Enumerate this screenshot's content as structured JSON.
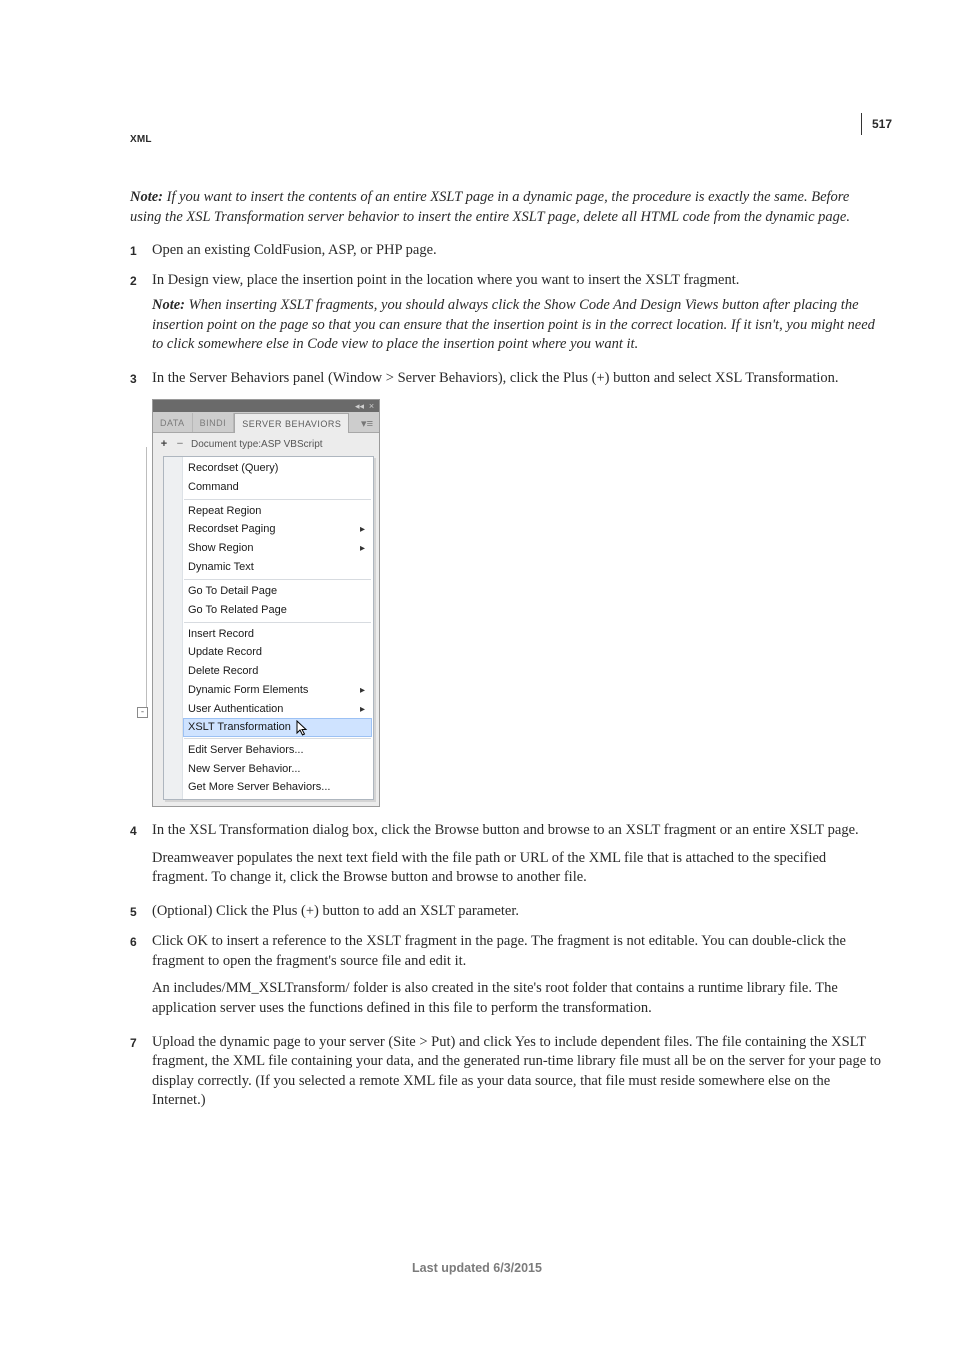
{
  "page_number": "517",
  "running_head": "XML",
  "intro_note": {
    "label": "Note:",
    "text": " If you want to insert the contents of an entire XSLT page in a dynamic page, the procedure is exactly the same. Before using the XSL Transformation server behavior to insert the entire XSLT page, delete all HTML code from the dynamic page."
  },
  "steps": [
    {
      "num": "1",
      "text": "Open an existing ColdFusion, ASP, or PHP page."
    },
    {
      "num": "2",
      "text": "In Design view, place the insertion point in the location where you want to insert the XSLT fragment.",
      "note": {
        "label": "Note:",
        "text": " When inserting XSLT fragments, you should always click the Show Code And Design Views button after placing the insertion point on the page so that you can ensure that the insertion point is in the correct location. If it isn't, you might need to click somewhere else in Code view to place the insertion point where you want it."
      }
    },
    {
      "num": "3",
      "text": "In the Server Behaviors panel (Window > Server Behaviors), click the Plus (+) button and select XSL Transformation."
    },
    {
      "num": "4",
      "text": "In the XSL Transformation dialog box, click the Browse button and browse to an XSLT fragment or an entire XSLT page.",
      "followups": [
        "Dreamweaver populates the next text field with the file path or URL of the XML file that is attached to the specified fragment. To change it, click the Browse button and browse to another file."
      ]
    },
    {
      "num": "5",
      "text": "(Optional) Click the Plus (+) button to add an XSLT parameter."
    },
    {
      "num": "6",
      "text": "Click OK to insert a reference to the XSLT fragment in the page. The fragment is not editable. You can double-click the fragment to open the fragment's source file and edit it.",
      "followups": [
        "An includes/MM_XSLTransform/ folder is also created in the site's root folder that contains a runtime library file. The application server uses the functions defined in this file to perform the transformation."
      ]
    },
    {
      "num": "7",
      "text": "Upload the dynamic page to your server (Site > Put) and click Yes to include dependent files. The file containing the XSLT fragment, the XML file containing your data, and the generated run-time library file must all be on the server for your page to display correctly. (If you selected a remote XML file as your data source, that file must reside somewhere else on the Internet.)"
    }
  ],
  "panel": {
    "tabs": [
      "DATA",
      "BINDI",
      "SERVER BEHAVIORS"
    ],
    "active_tab": "SERVER BEHAVIORS",
    "doc_type_label": "Document type:ASP VBScript",
    "plus": "+",
    "minus": "−",
    "groups": [
      [
        "Recordset (Query)",
        "Command"
      ],
      [
        "Repeat Region",
        "Recordset Paging",
        "Show Region",
        "Dynamic Text"
      ],
      [
        "Go To Detail Page",
        "Go To Related Page"
      ],
      [
        "Insert Record",
        "Update Record",
        "Delete Record",
        "Dynamic Form Elements",
        "User Authentication",
        "XSLT Transformation"
      ],
      [
        "Edit Server Behaviors...",
        "New Server Behavior...",
        "Get More Server Behaviors..."
      ]
    ],
    "submenu_items": [
      "Recordset Paging",
      "Show Region",
      "Dynamic Form Elements",
      "User Authentication"
    ],
    "highlight": "XSLT Transformation"
  },
  "footer": "Last updated 6/3/2015"
}
